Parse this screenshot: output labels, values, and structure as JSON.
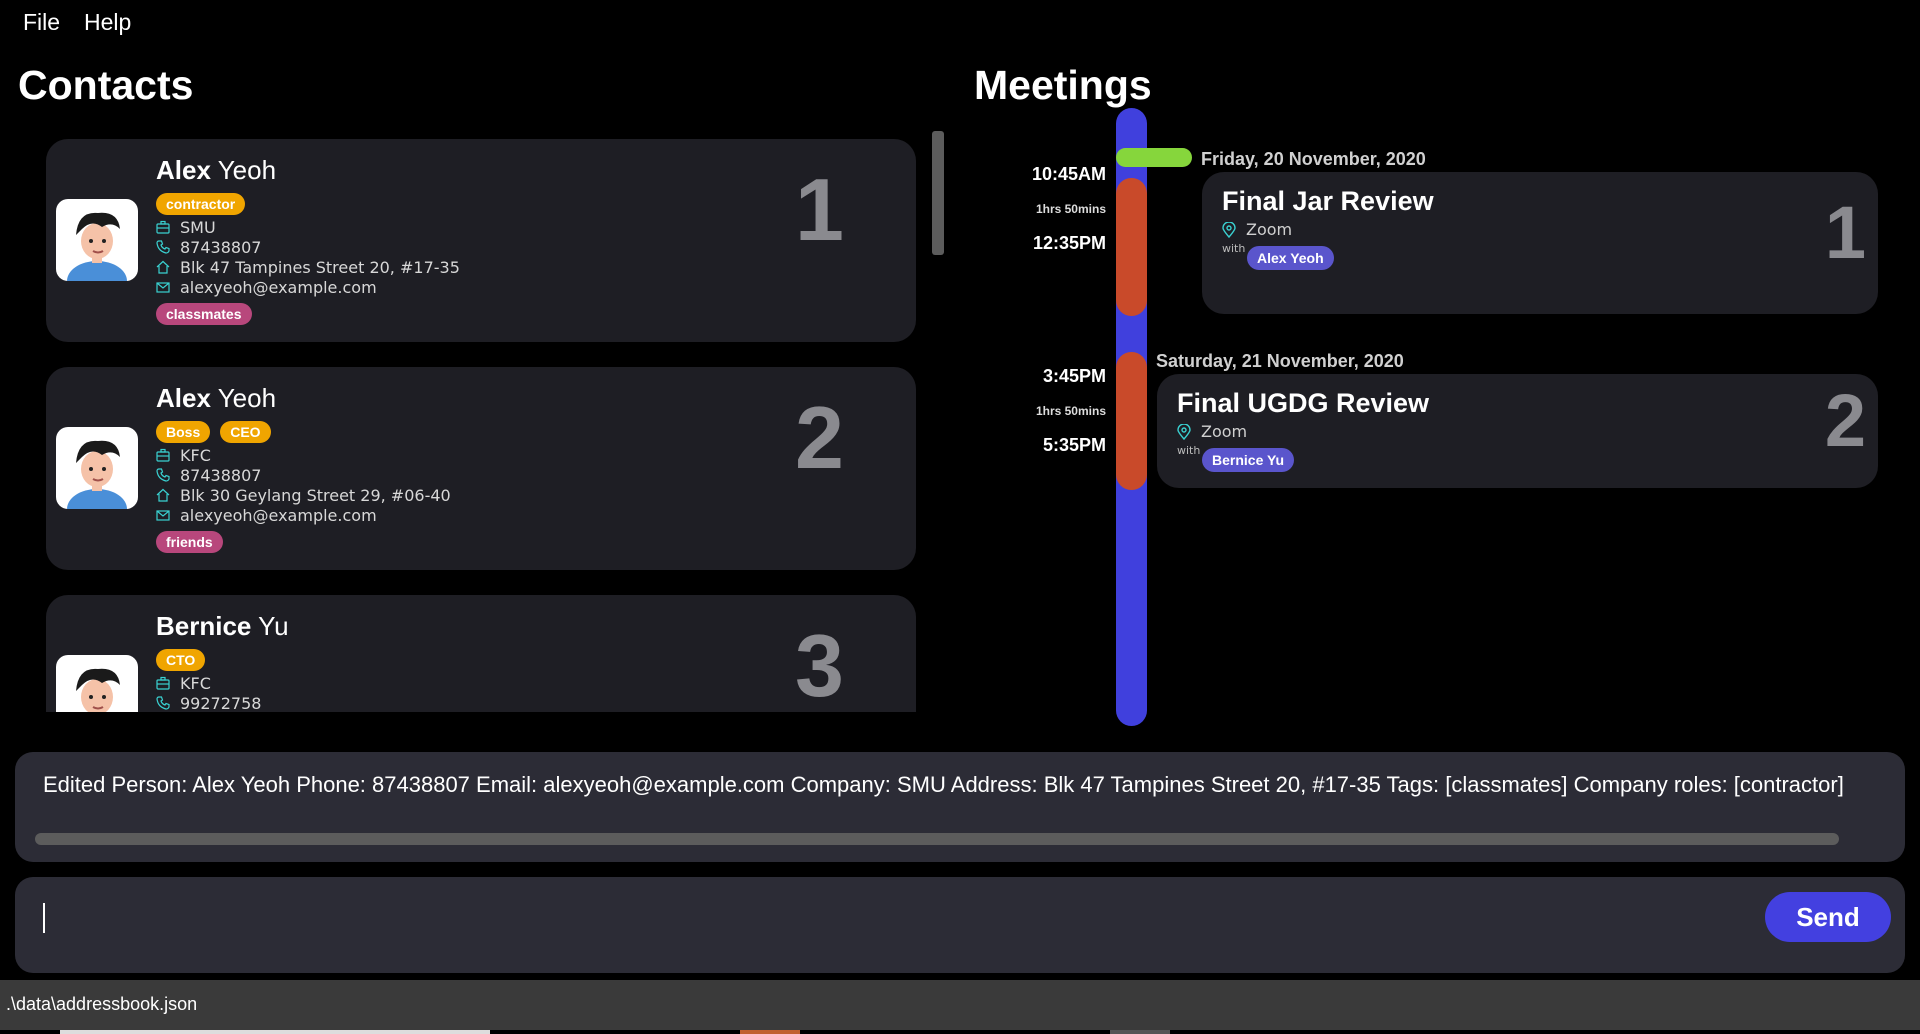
{
  "menu": {
    "file": "File",
    "help": "Help"
  },
  "contacts": {
    "title": "Contacts",
    "cards": [
      {
        "first": "Alex",
        "last": "Yeoh",
        "index": "1",
        "roles": [
          "contractor"
        ],
        "company": "SMU",
        "phone": "87438807",
        "address": "Blk 47 Tampines Street 20, #17-35",
        "email": "alexyeoh@example.com",
        "tags": [
          "classmates"
        ]
      },
      {
        "first": "Alex",
        "last": "Yeoh",
        "index": "2",
        "roles": [
          "Boss",
          "CEO"
        ],
        "company": "KFC",
        "phone": "87438807",
        "address": "Blk 30 Geylang Street 29, #06-40",
        "email": "alexyeoh@example.com",
        "tags": [
          "friends"
        ]
      },
      {
        "first": "Bernice",
        "last": "Yu",
        "index": "3",
        "roles": [
          "CTO"
        ],
        "company": "KFC",
        "phone": "99272758"
      }
    ]
  },
  "meetings": {
    "title": "Meetings",
    "items": [
      {
        "start": "10:45AM",
        "duration": "1hrs 50mins",
        "end": "12:35PM",
        "date": "Friday, 20 November, 2020",
        "title": "Final Jar Review",
        "place": "Zoom",
        "with_label": "with",
        "person": "Alex Yeoh",
        "index": "1"
      },
      {
        "start": "3:45PM",
        "duration": "1hrs 50mins",
        "end": "5:35PM",
        "date": "Saturday, 21 November, 2020",
        "title": "Final UGDG Review",
        "place": "Zoom",
        "with_label": "with",
        "person": "Bernice Yu",
        "index": "2"
      }
    ]
  },
  "result": {
    "text": "Edited Person: Alex Yeoh Phone: 87438807 Email: alexyeoh@example.com Company: SMU Address: Blk 47 Tampines Street 20, #17-35 Tags: [classmates] Company roles: [contractor]"
  },
  "command": {
    "value": "",
    "send_label": "Send"
  },
  "status": {
    "path": ".\\data\\addressbook.json"
  },
  "colors": {
    "background": "#000000",
    "card": "#1e1e24",
    "role_tag": "#f0a500",
    "group_tag": "#b8477c",
    "person_chip": "#5a55cc",
    "timeline": "#4040dd",
    "meeting_block": "#c94a2a",
    "now_marker": "#86d63c",
    "send_button": "#4340e0",
    "icon_accent": "#3ad1d1"
  }
}
